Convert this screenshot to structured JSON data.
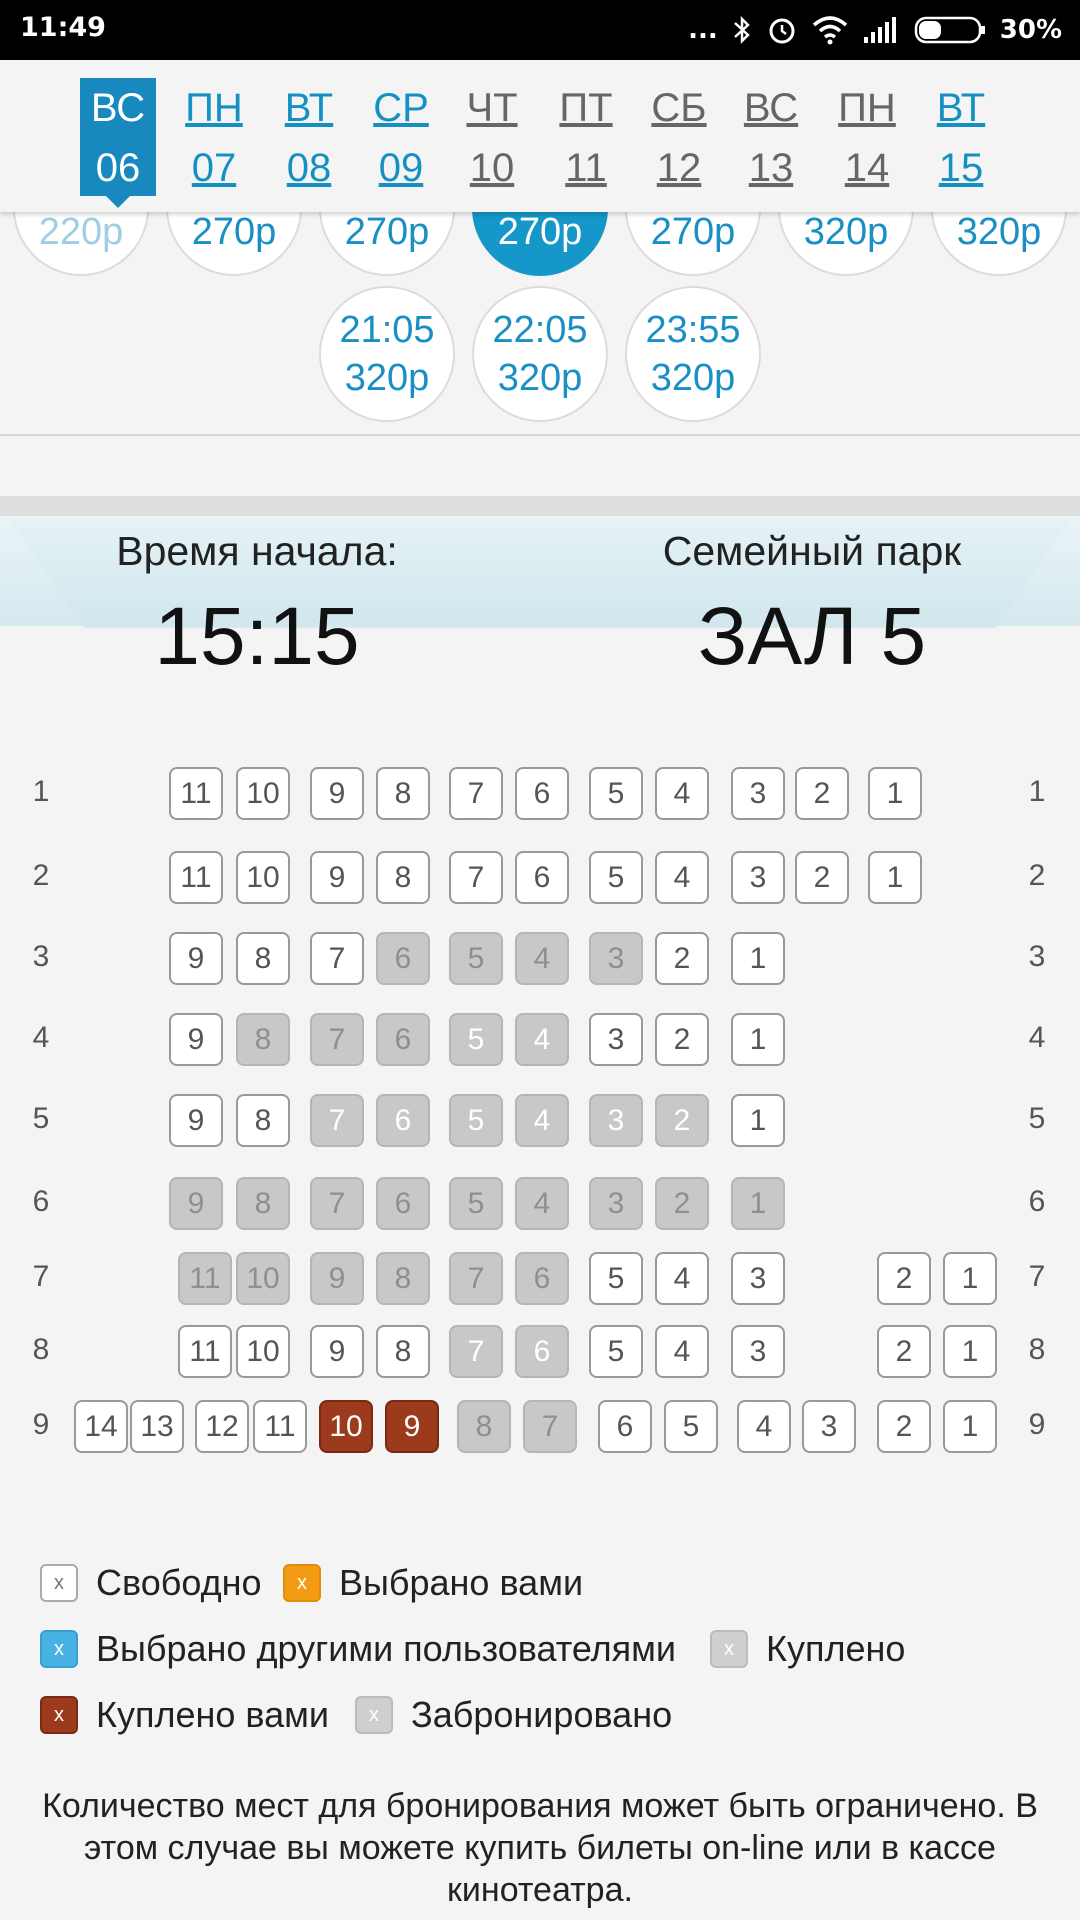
{
  "status_bar": {
    "time": "11:49",
    "battery": "30%",
    "dots": "..."
  },
  "dates": [
    {
      "dow": "ВС",
      "num": "06",
      "style": "active"
    },
    {
      "dow": "ПН",
      "num": "07",
      "style": "blue"
    },
    {
      "dow": "ВТ",
      "num": "08",
      "style": "blue"
    },
    {
      "dow": "СР",
      "num": "09",
      "style": "blue"
    },
    {
      "dow": "ЧТ",
      "num": "10",
      "style": "gray"
    },
    {
      "dow": "ПТ",
      "num": "11",
      "style": "gray"
    },
    {
      "dow": "СБ",
      "num": "12",
      "style": "gray"
    },
    {
      "dow": "ВС",
      "num": "13",
      "style": "gray"
    },
    {
      "dow": "ПН",
      "num": "14",
      "style": "gray"
    },
    {
      "dow": "ВТ",
      "num": "15",
      "style": "blue"
    }
  ],
  "showtimes_row1": [
    {
      "price": "220р",
      "state": "faded"
    },
    {
      "price": "270р",
      "state": "normal"
    },
    {
      "price": "270р",
      "state": "normal"
    },
    {
      "price": "270р",
      "state": "selected"
    },
    {
      "price": "270р",
      "state": "normal"
    },
    {
      "price": "320р",
      "state": "normal"
    },
    {
      "price": "320р",
      "state": "normal"
    }
  ],
  "showtimes_row2": [
    {
      "time": "21:05",
      "price": "320р"
    },
    {
      "time": "22:05",
      "price": "320р"
    },
    {
      "time": "23:55",
      "price": "320р"
    }
  ],
  "info": {
    "start_label": "Время начала:",
    "start_time": "15:15",
    "venue": "Семейный парк",
    "hall": "ЗАЛ 5"
  },
  "rows": [
    {
      "row": "1",
      "seats": [
        [
          "11",
          "free"
        ],
        [
          "10",
          "free"
        ],
        [
          "9",
          "free"
        ],
        [
          "8",
          "free"
        ],
        [
          "7",
          "free"
        ],
        [
          "6",
          "free"
        ],
        [
          "5",
          "free"
        ],
        [
          "4",
          "free"
        ],
        [
          "3",
          "free"
        ],
        [
          "2",
          "free"
        ],
        [
          "1",
          "free"
        ]
      ]
    },
    {
      "row": "2",
      "seats": [
        [
          "11",
          "free"
        ],
        [
          "10",
          "free"
        ],
        [
          "9",
          "free"
        ],
        [
          "8",
          "free"
        ],
        [
          "7",
          "free"
        ],
        [
          "6",
          "free"
        ],
        [
          "5",
          "free"
        ],
        [
          "4",
          "free"
        ],
        [
          "3",
          "free"
        ],
        [
          "2",
          "free"
        ],
        [
          "1",
          "free"
        ]
      ]
    },
    {
      "row": "3",
      "seats": [
        [
          "9",
          "free"
        ],
        [
          "8",
          "free"
        ],
        [
          "7",
          "free"
        ],
        [
          "6",
          "taken"
        ],
        [
          "5",
          "taken"
        ],
        [
          "4",
          "taken"
        ],
        [
          "3",
          "taken"
        ],
        [
          "2",
          "free"
        ],
        [
          "1",
          "free"
        ]
      ]
    },
    {
      "row": "4",
      "seats": [
        [
          "9",
          "free"
        ],
        [
          "8",
          "taken"
        ],
        [
          "7",
          "taken"
        ],
        [
          "6",
          "taken"
        ],
        [
          "5",
          "booked"
        ],
        [
          "4",
          "booked"
        ],
        [
          "3",
          "free"
        ],
        [
          "2",
          "free"
        ],
        [
          "1",
          "free"
        ]
      ]
    },
    {
      "row": "5",
      "seats": [
        [
          "9",
          "free"
        ],
        [
          "8",
          "free"
        ],
        [
          "7",
          "booked"
        ],
        [
          "6",
          "booked"
        ],
        [
          "5",
          "booked"
        ],
        [
          "4",
          "booked"
        ],
        [
          "3",
          "booked"
        ],
        [
          "2",
          "booked"
        ],
        [
          "1",
          "free"
        ]
      ]
    },
    {
      "row": "6",
      "seats": [
        [
          "9",
          "taken"
        ],
        [
          "8",
          "taken"
        ],
        [
          "7",
          "taken"
        ],
        [
          "6",
          "taken"
        ],
        [
          "5",
          "taken"
        ],
        [
          "4",
          "taken"
        ],
        [
          "3",
          "taken"
        ],
        [
          "2",
          "taken"
        ],
        [
          "1",
          "taken"
        ]
      ]
    },
    {
      "row": "7",
      "seats": [
        [
          "11",
          "taken"
        ],
        [
          "10",
          "taken"
        ],
        [
          "9",
          "taken"
        ],
        [
          "8",
          "taken"
        ],
        [
          "7",
          "taken"
        ],
        [
          "6",
          "taken"
        ],
        [
          "5",
          "free"
        ],
        [
          "4",
          "free"
        ],
        [
          "3",
          "free"
        ],
        [
          "2",
          "free"
        ],
        [
          "1",
          "free"
        ]
      ]
    },
    {
      "row": "8",
      "seats": [
        [
          "11",
          "free"
        ],
        [
          "10",
          "free"
        ],
        [
          "9",
          "free"
        ],
        [
          "8",
          "free"
        ],
        [
          "7",
          "booked"
        ],
        [
          "6",
          "booked"
        ],
        [
          "5",
          "free"
        ],
        [
          "4",
          "free"
        ],
        [
          "3",
          "free"
        ],
        [
          "2",
          "free"
        ],
        [
          "1",
          "free"
        ]
      ]
    },
    {
      "row": "9",
      "seats": [
        [
          "14",
          "free"
        ],
        [
          "13",
          "free"
        ],
        [
          "12",
          "free"
        ],
        [
          "11",
          "free"
        ],
        [
          "10",
          "mine"
        ],
        [
          "9",
          "mine"
        ],
        [
          "8",
          "taken"
        ],
        [
          "7",
          "taken"
        ],
        [
          "6",
          "free"
        ],
        [
          "5",
          "free"
        ],
        [
          "4",
          "free"
        ],
        [
          "3",
          "free"
        ],
        [
          "2",
          "free"
        ],
        [
          "1",
          "free"
        ]
      ]
    }
  ],
  "legend": {
    "box_mark": "x",
    "free": "Свободно",
    "selected_by_you": "Выбрано вами",
    "selected_by_others": "Выбрано другими пользователями",
    "purchased": "Куплено",
    "purchased_by_you": "Куплено вами",
    "reserved": "Забронировано"
  },
  "note": "Количество мест для бронирования может быть ограничено. В этом случае вы можете купить билеты on-line или в кассе кинотеатра.",
  "colors": {
    "accent_blue": "#1889bf",
    "selected_orange": "#f49b16",
    "others_blue": "#49b2e4",
    "purchased_gray": "#cfcfcf",
    "mine_red": "#9c3a1d"
  }
}
